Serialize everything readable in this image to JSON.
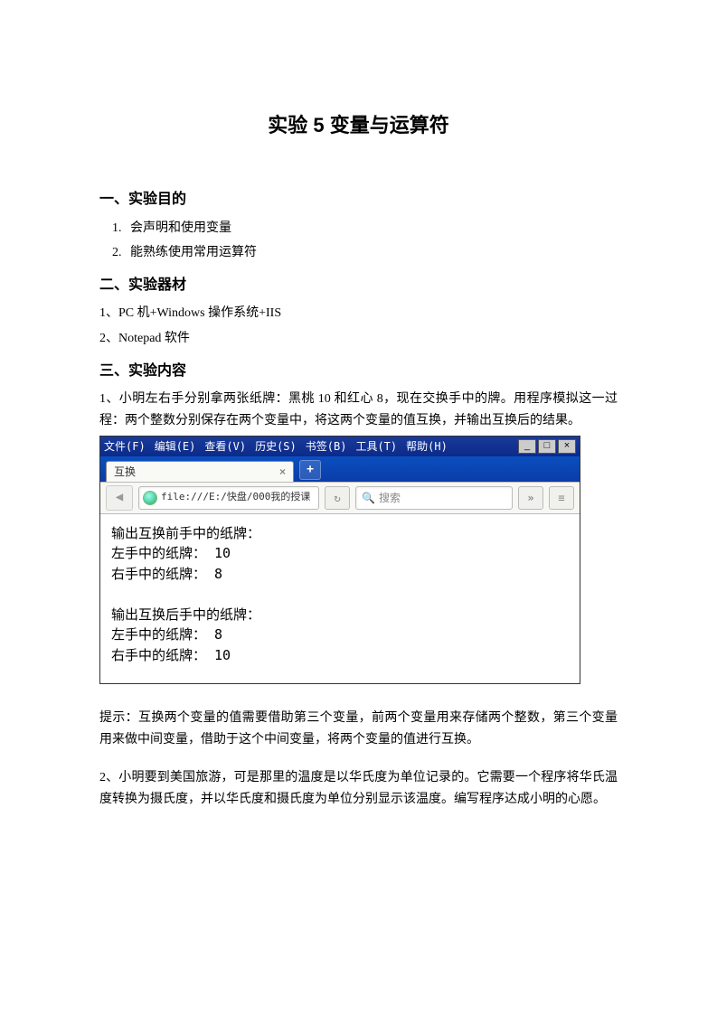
{
  "title": "实验 5 变量与运算符",
  "sections": {
    "s1": {
      "heading": "一、实验目的",
      "items": [
        "会声明和使用变量",
        "能熟练使用常用运算符"
      ]
    },
    "s2": {
      "heading": "二、实验器材",
      "items": [
        "1、PC 机+Windows 操作系统+IIS",
        "2、Notepad 软件"
      ]
    },
    "s3": {
      "heading": "三、实验内容",
      "task1": "1、小明左右手分别拿两张纸牌：黑桃 10 和红心 8，现在交换手中的牌。用程序模拟这一过程：两个整数分别保存在两个变量中，将这两个变量的值互换，并输出互换后的结果。",
      "hint": "提示：互换两个变量的值需要借助第三个变量，前两个变量用来存储两个整数，第三个变量用来做中间变量，借助于这个中间变量，将两个变量的值进行互换。",
      "task2": "2、小明要到美国旅游，可是那里的温度是以华氏度为单位记录的。它需要一个程序将华氏温度转换为摄氏度，并以华氏度和摄氏度为单位分别显示该温度。编写程序达成小明的心愿。"
    }
  },
  "browser": {
    "menu": {
      "file": "文件(F)",
      "edit": "编辑(E)",
      "view": "查看(V)",
      "history": "历史(S)",
      "bookmark": "书签(B)",
      "tools": "工具(T)",
      "help": "帮助(H)"
    },
    "tab_title": "互换",
    "url": "file:///E:/快盘/000我的授课",
    "search_placeholder": "搜索",
    "output": {
      "before_heading": "输出互换前手中的纸牌：",
      "left_before": "左手中的纸牌：  10",
      "right_before": "右手中的纸牌：  8",
      "after_heading": "输出互换后手中的纸牌：",
      "left_after": "左手中的纸牌：  8",
      "right_after": "右手中的纸牌：  10"
    }
  }
}
